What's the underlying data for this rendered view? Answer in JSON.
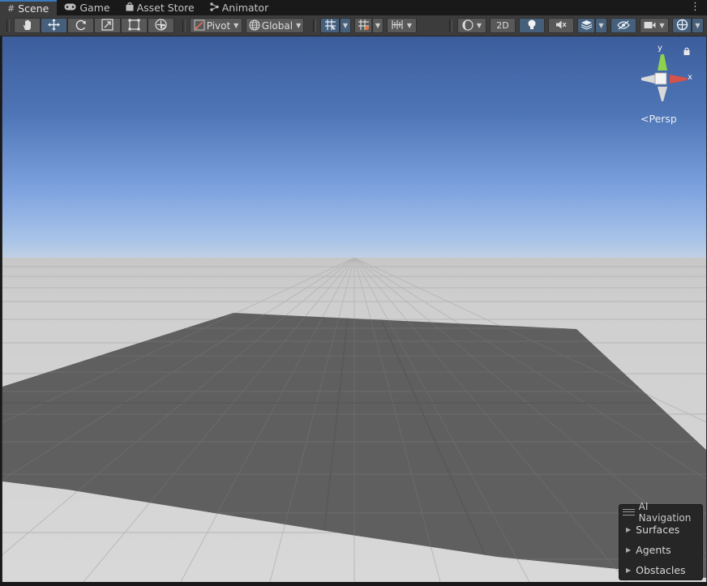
{
  "tabs": [
    {
      "label": "Scene",
      "icon": "grid-icon",
      "active": true
    },
    {
      "label": "Game",
      "icon": "gamepad-icon",
      "active": false
    },
    {
      "label": "Asset Store",
      "icon": "bag-icon",
      "active": false
    },
    {
      "label": "Animator",
      "icon": "animator-icon",
      "active": false
    }
  ],
  "toolbar": {
    "pivot_label": "Pivot",
    "global_label": "Global",
    "mode_2d_label": "2D",
    "active_tool": "move-tool"
  },
  "gizmo": {
    "y_label": "y",
    "x_label": "x",
    "projection_label": "Persp"
  },
  "overlay": {
    "title": "AI Navigation",
    "items": [
      "Surfaces",
      "Agents",
      "Obstacles"
    ]
  },
  "colors": {
    "tab_active": "#3c3c3c",
    "toolbar": "#3c3c3c",
    "button": "#585858",
    "button_active": "#46607c",
    "sky_top": "#3a5f9f",
    "sky_horizon": "#a6c3e8",
    "ground": "#d2d2d2",
    "plane": "#5e5e5e",
    "axis_y": "#8fd14f",
    "axis_x": "#d5534a"
  }
}
